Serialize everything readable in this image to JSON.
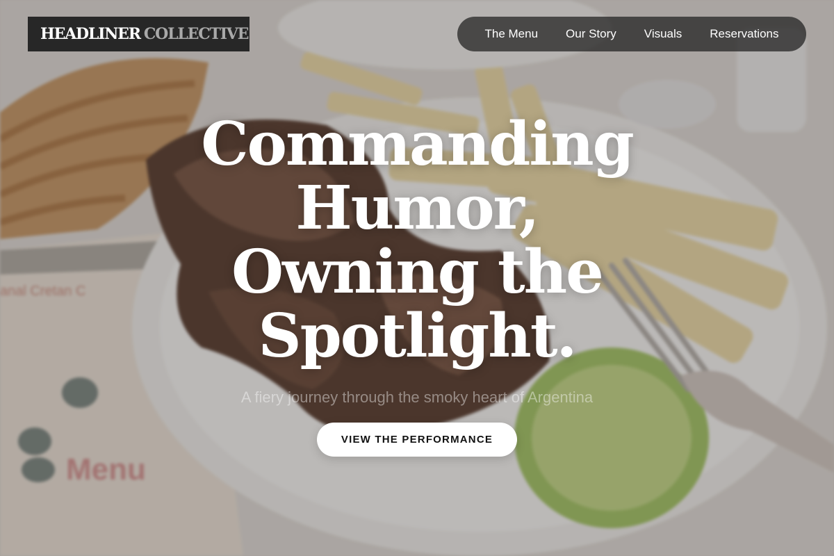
{
  "brand": {
    "primary": "HEADLINER",
    "secondary": "COLLECTIVE"
  },
  "nav": {
    "items": [
      {
        "label": "The Menu"
      },
      {
        "label": "Our Story"
      },
      {
        "label": "Visuals"
      },
      {
        "label": "Reservations"
      }
    ]
  },
  "hero": {
    "title_lines": [
      "Commanding",
      "Humor,",
      "Owning the",
      "Spotlight."
    ],
    "subtitle": "A fiery journey through the smoky heart of Argentina",
    "cta_label": "VIEW THE PERFORMANCE",
    "background_image": "grilled-steak-with-fries-and-lime-photo"
  },
  "colors": {
    "logo_bg": "#1c1c1c",
    "nav_bg": "#1e1e1e",
    "cta_bg": "#ffffff",
    "title_text": "#ffffff"
  }
}
